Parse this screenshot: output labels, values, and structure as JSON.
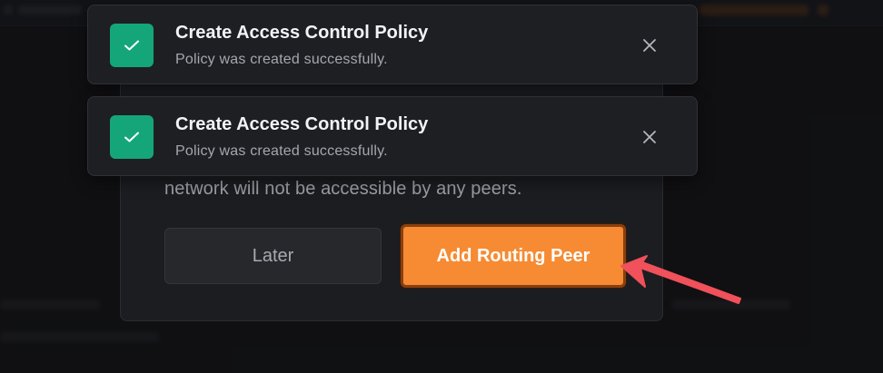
{
  "toasts": [
    {
      "title": "Create Access Control Policy",
      "message": "Policy was created successfully.",
      "status_color": "#14a679",
      "icon": "check-icon",
      "close_icon": "close-icon"
    },
    {
      "title": "Create Access Control Policy",
      "message": "Policy was created successfully.",
      "status_color": "#14a679",
      "icon": "check-icon",
      "close_icon": "close-icon"
    }
  ],
  "modal": {
    "body_text": "network will not be accessible by any peers.",
    "secondary_button": "Later",
    "primary_button": "Add Routing Peer",
    "primary_color": "#f68b33"
  },
  "annotation": {
    "arrow_color": "#f0515a",
    "target": "primary-button"
  }
}
